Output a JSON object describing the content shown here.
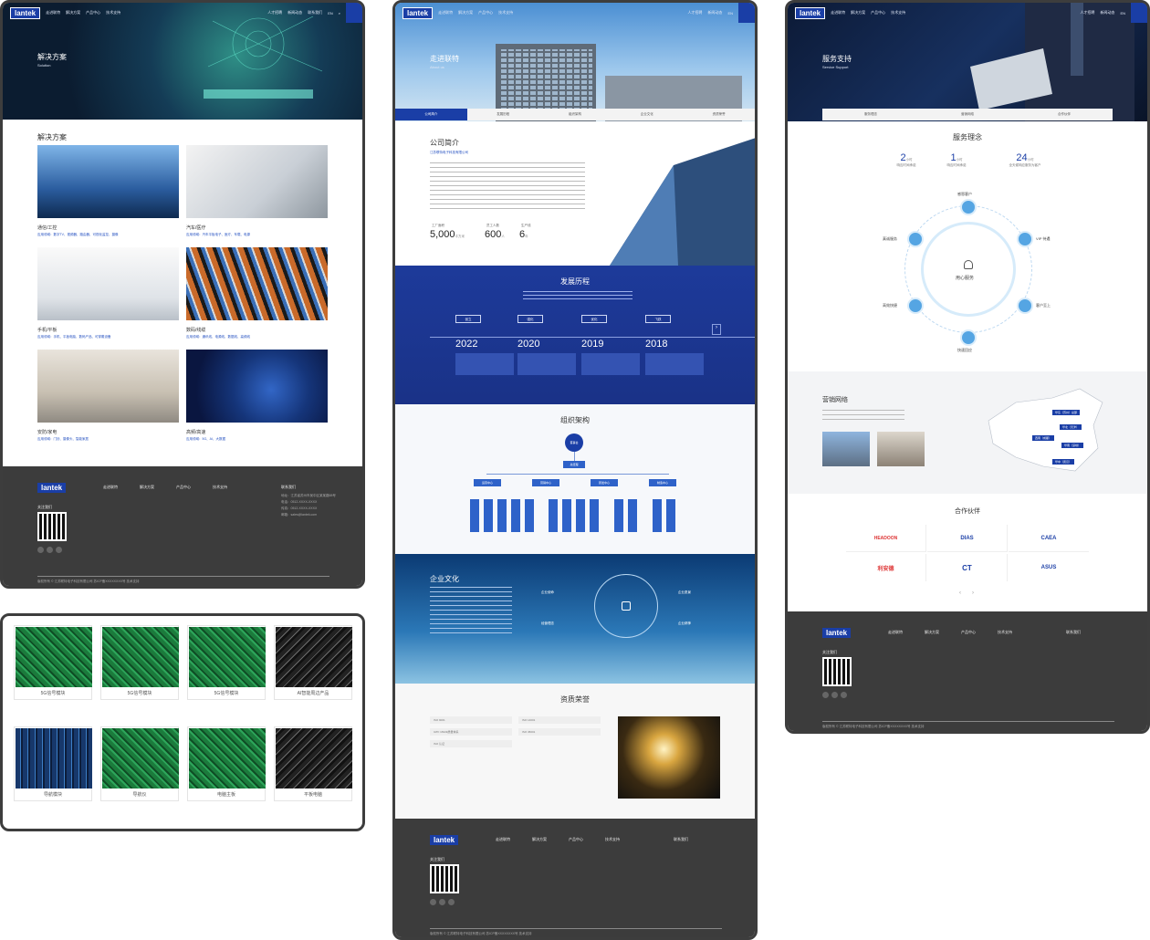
{
  "brand": "lantek",
  "nav": {
    "items": [
      "走进联特",
      "解决方案",
      "产品中心",
      "技术支持",
      "人才招聘",
      "新闻动态",
      "联系我们"
    ],
    "lang": "EN"
  },
  "frame1": {
    "hero_title": "解决方案",
    "hero_en": "Solution",
    "section_title": "解决方案",
    "tiles": [
      {
        "name": "通信/工控",
        "desc": "应用领域：数字TV、视频器、路由器、可视化监控、摄像"
      },
      {
        "name": "汽车/医疗",
        "desc": "应用领域：汽车平板电子、医疗、车载、电源"
      },
      {
        "name": "手机/平板",
        "desc": "应用领域：手机、平板电脑、数码产品、可穿戴设备"
      },
      {
        "name": "数码/线缆",
        "desc": "应用领域：通讯线、电源线、数据线、高频线"
      },
      {
        "name": "安防/家电",
        "desc": "应用领域：门铃、摄像头、智能家居"
      },
      {
        "name": "高频/高速",
        "desc": "应用领域：5G、AI、大数据"
      }
    ]
  },
  "footer": {
    "cols": [
      {
        "title": "走进联特",
        "items": [
          "公司简介",
          "发展历程",
          "组织架构",
          "企业文化",
          "资质荣誉",
          "营销网络"
        ]
      },
      {
        "title": "解决方案",
        "items": [
          "通信/工控",
          "汽车/医疗",
          "手机/平板",
          "数码/线缆",
          "安防/家电",
          "高频/高速"
        ]
      },
      {
        "title": "产品中心",
        "items": [
          "5G模块",
          "导航模块",
          "电脑主板"
        ]
      },
      {
        "title": "技术支持",
        "items": [
          "服务理念",
          "营销网络"
        ]
      }
    ],
    "contact_title": "联系我们",
    "contact_lines": [
      "地址：江苏省苏州市吴中区某某路88号",
      "电话：0512-XXXX-XXXX",
      "传真：0512-XXXX-XXXX",
      "邮箱：sales@lantek.com"
    ],
    "follow": "关注我们",
    "copyright": "版权所有 © 江苏联特电子科技有限公司   苏ICP备XXXXXXXX号   技术支持"
  },
  "frame2": {
    "products": [
      "5G信号模块",
      "5G信号模块",
      "5G信号模块",
      "AI智能周边产品",
      "导航模块",
      "导航仪",
      "电脑主板",
      "平板电脑"
    ]
  },
  "frame3": {
    "hero_title": "走进联特",
    "hero_en": "About us",
    "tabs": [
      "公司简介",
      "发展历程",
      "组织架构",
      "企业文化",
      "资质荣誉"
    ],
    "intro_title": "公司简介",
    "company": "江苏联特电子科技有限公司",
    "stats": [
      {
        "num": "5,000",
        "unit": "平方米",
        "label": "工厂面积"
      },
      {
        "num": "600",
        "unit": "人",
        "label": "员工人数"
      },
      {
        "num": "6",
        "unit": "年",
        "label": "生产线"
      }
    ],
    "history_title": "发展历程",
    "history_tags": [
      "创立",
      "强化",
      "优化",
      "飞跃"
    ],
    "years": [
      "2022",
      "2020",
      "2019",
      "2018"
    ],
    "org_title": "组织架构",
    "org_top": "董事会",
    "org_second": "总经理",
    "org_depts": [
      "运营中心",
      "营销中心",
      "研发中心",
      "制造中心"
    ],
    "culture_title": "企业文化",
    "culture_items": [
      "企业使命",
      "企业愿景",
      "经营理念",
      "企业精神"
    ],
    "honor_title": "资质荣誉",
    "honors": [
      "ISO 9001",
      "ISO 14001",
      "IATF 16949质量体系",
      "ISO 45001",
      "ISO 认证"
    ]
  },
  "frame4": {
    "hero_title": "服务支持",
    "hero_en": "Service Support",
    "tabs": [
      "服务理念",
      "营销网络",
      "合作伙伴"
    ],
    "concept_title": "服务理念",
    "stats": [
      {
        "num": "2",
        "unit": "小时",
        "label": "响应时间承诺"
      },
      {
        "num": "1",
        "unit": "小时",
        "label": "响应时间承诺"
      },
      {
        "num": "24",
        "unit": "小时",
        "label": "全天候响应服务为客户"
      }
    ],
    "ring_center": "用心服务",
    "ring_nodes": [
      "感恩客户",
      "VIP 待遇",
      "真诚服务",
      "客户至上",
      "高效快捷",
      "快速回应"
    ],
    "network_title": "营销网络",
    "map_tags": [
      "华东（苏州）总部",
      "华北（天津）",
      "西南（成都）",
      "华南（深圳）",
      "华中（武汉）"
    ],
    "partners_title": "合作伙伴",
    "partners": [
      "HEADOON",
      "DIAS",
      "CAEA",
      "利安德",
      "CT",
      "ASUS"
    ]
  }
}
